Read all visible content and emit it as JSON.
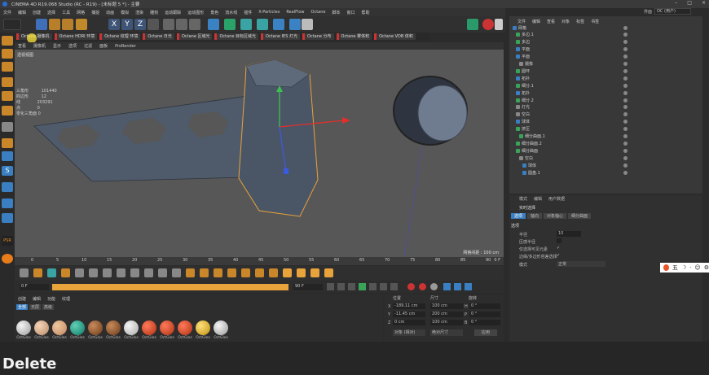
{
  "window": {
    "title": "CINEMA 4D R19.068 Studio (RC - R19) - [未标题 5 *] - 主要",
    "controls": [
      "–",
      "□",
      "×"
    ]
  },
  "menu": [
    "文件",
    "编辑",
    "创建",
    "选择",
    "工具",
    "网格",
    "捕捉",
    "动画",
    "模拟",
    "渲染",
    "雕刻",
    "运动跟踪",
    "运动图形",
    "角色",
    "流水线",
    "插件",
    "X-Particles",
    "RealFlow",
    "Octane",
    "脚本",
    "窗口",
    "帮助"
  ],
  "layout": {
    "label": "界面",
    "value": "OC (用户)"
  },
  "octane_bar": [
    "Octane 摄像机",
    "Octane HDRI 环境",
    "Octane 纹理 环境",
    "Octane 日光",
    "Octane 区域光",
    "Octane 目标区域光",
    "Octane IES 灯光",
    "Octane 分布",
    "Octane 雾体积",
    "Octane VDB 体积"
  ],
  "viewport": {
    "menu": [
      "查看",
      "摄像机",
      "显示",
      "选项",
      "过滤",
      "面板",
      "ProRender"
    ],
    "label": "透视视图",
    "hud": [
      "三角形",
      "101440",
      "四边形",
      "12",
      "线",
      "203291",
      "点",
      "0",
      "零化三角面 0"
    ],
    "grid_label": "网格间距 : 100 cm"
  },
  "timeline": {
    "ticks": [
      "0",
      "5",
      "10",
      "15",
      "20",
      "25",
      "30",
      "35",
      "40",
      "45",
      "50",
      "55",
      "60",
      "65",
      "70",
      "75",
      "80",
      "85",
      "90"
    ],
    "end": "0 F"
  },
  "playbar": {
    "start": "0 F",
    "current": "0 F",
    "end": "90 F",
    "end2": "90 F"
  },
  "materials": {
    "menu": [
      "创建",
      "编辑",
      "功能",
      "纹理"
    ],
    "filters": [
      "全部",
      "无层",
      "高级"
    ],
    "label": "OctGlos",
    "count": 12
  },
  "coords": {
    "headers": [
      "位置",
      "尺寸",
      "旋转"
    ],
    "rows": [
      {
        "axis": "X",
        "pos": "-189.11 cm",
        "size": "100 cm",
        "rot_label": "H",
        "rot": "0 °"
      },
      {
        "axis": "Y",
        "pos": "-11.45 cm",
        "size": "200 cm",
        "rot_label": "P",
        "rot": "0 °"
      },
      {
        "axis": "Z",
        "pos": "0 cm",
        "size": "100 cm",
        "rot_label": "B",
        "rot": "0 °"
      }
    ],
    "mode": "对象 (相对)",
    "sizemode": "绝对尺寸",
    "apply": "应用"
  },
  "objects": {
    "menu": [
      "文件",
      "编辑",
      "查看",
      "对象",
      "标签",
      "书签"
    ],
    "items": [
      "网格",
      "多边.1",
      "多边",
      "平面",
      "平面",
      "摄像",
      "圆环",
      "拓扑",
      "细分.1",
      "拓扑",
      "细分.2",
      "灯光",
      "空白",
      "球体",
      "挤压",
      "细分曲面.1",
      "细分曲面.2",
      "细分曲面",
      "空白",
      "球体",
      "圆盘.1"
    ]
  },
  "attributes": {
    "menu": [
      "模式",
      "编辑",
      "用户数据"
    ],
    "mode_label": "实时选择",
    "tabs": [
      "选项",
      "轴向",
      "对象轴心",
      "细分曲面"
    ],
    "section": "选项",
    "fields": [
      {
        "label": "半径",
        "value": "10"
      },
      {
        "label": "压感半径",
        "value": ""
      },
      {
        "label": "仅选择可见元素",
        "value": "✓"
      },
      {
        "label": "边缘/多边形容差选择",
        "value": "✓"
      },
      {
        "label": "模式",
        "value": "正常"
      }
    ]
  },
  "ime": [
    "五",
    "☽",
    "·",
    "☺",
    "⚙"
  ],
  "status": "Delete",
  "colors": {
    "accent": "#e8a33b",
    "hud": "#d0d0d0"
  }
}
